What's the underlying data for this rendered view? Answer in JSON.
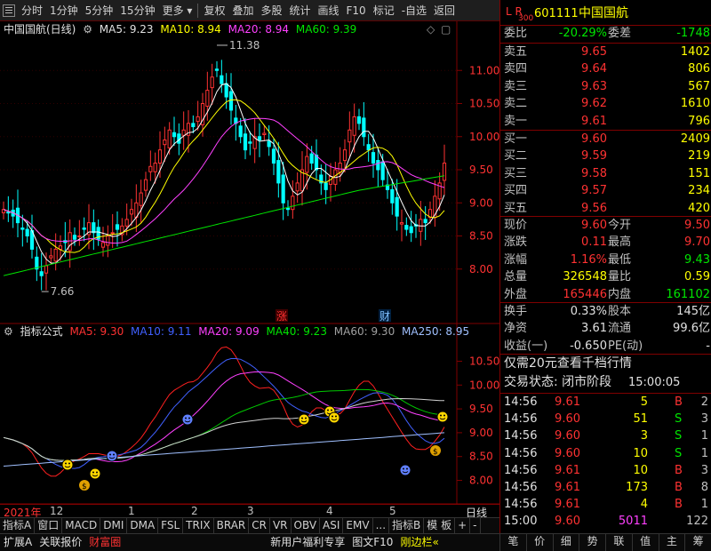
{
  "toolbar": {
    "items": [
      "分时",
      "1分钟",
      "5分钟",
      "15分钟",
      "更多",
      "复权",
      "叠加",
      "多股",
      "统计",
      "画线",
      "F10",
      "标记",
      "-自选",
      "返回"
    ]
  },
  "main": {
    "title": "中国国航(日线)",
    "ma5": "MA5: 9.23",
    "ma10": "MA10: 8.94",
    "ma20": "MA20: 8.94",
    "ma60": "MA60: 9.39",
    "high_label": "11.38",
    "low_label": "7.66",
    "zhang_marker": "涨",
    "cai_marker": "财",
    "yticks": [
      "11.00",
      "10.50",
      "10.00",
      "9.50",
      "9.00",
      "8.50",
      "8.00"
    ]
  },
  "indicator": {
    "title": "指标公式",
    "ma5": "MA5: 9.30",
    "ma10": "MA10: 9.11",
    "ma20": "MA20: 9.09",
    "ma40": "MA40: 9.23",
    "ma60": "MA60: 9.30",
    "ma250": "MA250: 8.95",
    "yticks": [
      "10.50",
      "10.00",
      "9.50",
      "9.00",
      "8.50",
      "8.00"
    ]
  },
  "colors": {
    "up": "#ff3232",
    "down": "#00ffff",
    "ma5": "#ffffff",
    "ma10": "#ffff00",
    "ma20": "#ff40ff",
    "ma60": "#00e600",
    "ma40": "#00c800",
    "ma250": "#a0a0ff",
    "border": "#800000"
  },
  "chart_data": {
    "type": "candlestick",
    "title": "中国国航(日线)",
    "ylim": [
      7.5,
      11.5
    ],
    "series": [
      {
        "name": "MA5",
        "value": 9.23
      },
      {
        "name": "MA10",
        "value": 8.94
      },
      {
        "name": "MA20",
        "value": 8.94
      },
      {
        "name": "MA60",
        "value": 9.39
      }
    ],
    "high": 11.38,
    "low": 7.66,
    "closes": [
      8.9,
      8.85,
      8.8,
      8.7,
      8.6,
      8.5,
      8.3,
      8.0,
      7.9,
      8.05,
      8.2,
      8.3,
      8.35,
      8.4,
      8.55,
      8.45,
      8.5,
      8.6,
      8.7,
      8.55,
      8.45,
      8.4,
      8.5,
      8.55,
      8.6,
      8.65,
      8.75,
      8.9,
      9.0,
      9.15,
      9.35,
      9.55,
      9.6,
      9.8,
      9.95,
      10.1,
      10.0,
      9.9,
      10.1,
      10.2,
      10.15,
      10.3,
      10.5,
      10.7,
      10.9,
      11.0,
      10.8,
      10.6,
      10.4,
      10.2,
      10.0,
      9.8,
      9.9,
      10.0,
      9.95,
      10.05,
      9.85,
      9.6,
      9.3,
      9.0,
      8.9,
      9.1,
      9.3,
      9.5,
      9.7,
      9.6,
      9.5,
      9.3,
      9.2,
      9.4,
      9.5,
      9.6,
      9.8,
      10.1,
      10.3,
      10.2,
      10.0,
      9.8,
      9.6,
      9.5,
      9.35,
      9.2,
      9.0,
      8.8,
      8.7,
      8.6,
      8.55,
      8.65,
      8.75,
      8.7,
      8.9,
      9.1,
      9.3,
      9.6
    ]
  },
  "bottom_axis": {
    "labels": [
      "2021年",
      "12",
      "1",
      "2",
      "3",
      "4",
      "5"
    ],
    "right": "日线"
  },
  "bottom_tabs": [
    "指标A",
    "窗口",
    "MACD",
    "DMI",
    "DMA",
    "FSL",
    "TRIX",
    "BRAR",
    "CR",
    "VR",
    "OBV",
    "ASI",
    "EMV",
    "...",
    "指标B",
    "模 板",
    "+",
    "-"
  ],
  "status_bar": {
    "items": [
      "扩展A",
      "关联报价",
      "财富圈",
      "新用户福利专享",
      "图文F10",
      "刚边栏«"
    ]
  },
  "panel": {
    "lr": "L R",
    "code_prefix": "300",
    "code": "601111",
    "name": "中国国航",
    "weibi_label": "委比",
    "weibi": "-20.29%",
    "weicha_label": "委差",
    "weicha": "-1748",
    "asks": [
      {
        "label": "卖五",
        "price": "9.65",
        "vol": "1402"
      },
      {
        "label": "卖四",
        "price": "9.64",
        "vol": "806"
      },
      {
        "label": "卖三",
        "price": "9.63",
        "vol": "567"
      },
      {
        "label": "卖二",
        "price": "9.62",
        "vol": "1610"
      },
      {
        "label": "卖一",
        "price": "9.61",
        "vol": "796"
      }
    ],
    "bids": [
      {
        "label": "买一",
        "price": "9.60",
        "vol": "2409"
      },
      {
        "label": "买二",
        "price": "9.59",
        "vol": "219"
      },
      {
        "label": "买三",
        "price": "9.58",
        "vol": "151"
      },
      {
        "label": "买四",
        "price": "9.57",
        "vol": "234"
      },
      {
        "label": "买五",
        "price": "9.56",
        "vol": "420"
      }
    ],
    "quote": [
      {
        "l1": "现价",
        "v1": "9.60",
        "l2": "今开",
        "v2": "9.50"
      },
      {
        "l1": "涨跌",
        "v1": "0.11",
        "l2": "最高",
        "v2": "9.70"
      },
      {
        "l1": "涨幅",
        "v1": "1.16%",
        "l2": "最低",
        "v2": "9.43"
      },
      {
        "l1": "总量",
        "v1": "326548",
        "l2": "量比",
        "v2": "0.59"
      },
      {
        "l1": "外盘",
        "v1": "165446",
        "l2": "内盘",
        "v2": "161102"
      }
    ],
    "stats": [
      {
        "l1": "换手",
        "v1": "0.33%",
        "l2": "股本",
        "v2": "145亿"
      },
      {
        "l1": "净资",
        "v1": "3.61",
        "l2": "流通",
        "v2": "99.6亿"
      },
      {
        "l1": "收益(一)",
        "v1": "-0.650",
        "l2": "PE(动)",
        "v2": "-"
      }
    ],
    "promo": "仅需20元查看千档行情",
    "trade_state_label": "交易状态: 闭市阶段",
    "trade_state_time": "15:00:05",
    "ticks": [
      {
        "t": "14:56",
        "p": "9.61",
        "v": "5",
        "d": "B",
        "n": "2"
      },
      {
        "t": "14:56",
        "p": "9.60",
        "v": "51",
        "d": "S",
        "n": "3"
      },
      {
        "t": "14:56",
        "p": "9.60",
        "v": "3",
        "d": "S",
        "n": "1"
      },
      {
        "t": "14:56",
        "p": "9.60",
        "v": "10",
        "d": "S",
        "n": "1"
      },
      {
        "t": "14:56",
        "p": "9.61",
        "v": "10",
        "d": "B",
        "n": "3"
      },
      {
        "t": "14:56",
        "p": "9.61",
        "v": "173",
        "d": "B",
        "n": "8"
      },
      {
        "t": "14:56",
        "p": "9.61",
        "v": "4",
        "d": "B",
        "n": "1"
      },
      {
        "t": "15:00",
        "p": "9.60",
        "v": "5011",
        "d": "",
        "n": "122"
      }
    ],
    "tabs": [
      "笔",
      "价",
      "细",
      "势",
      "联",
      "值",
      "主",
      "筹"
    ]
  }
}
